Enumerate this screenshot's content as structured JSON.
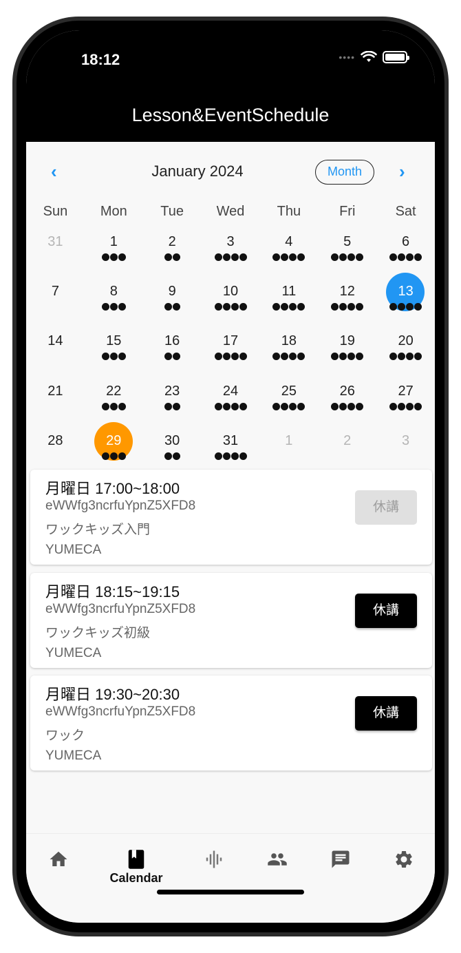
{
  "status": {
    "time": "18:12"
  },
  "app": {
    "title": "Lesson&EventSchedule"
  },
  "calendar": {
    "month_label": "January 2024",
    "view_button": "Month",
    "weekdays": [
      "Sun",
      "Mon",
      "Tue",
      "Wed",
      "Thu",
      "Fri",
      "Sat"
    ],
    "weeks": [
      [
        {
          "d": "31",
          "dots": 0,
          "other": true
        },
        {
          "d": "1",
          "dots": 3
        },
        {
          "d": "2",
          "dots": 2
        },
        {
          "d": "3",
          "dots": 4
        },
        {
          "d": "4",
          "dots": 4
        },
        {
          "d": "5",
          "dots": 4
        },
        {
          "d": "6",
          "dots": 4
        }
      ],
      [
        {
          "d": "7",
          "dots": 0
        },
        {
          "d": "8",
          "dots": 3
        },
        {
          "d": "9",
          "dots": 2
        },
        {
          "d": "10",
          "dots": 4
        },
        {
          "d": "11",
          "dots": 4
        },
        {
          "d": "12",
          "dots": 4
        },
        {
          "d": "13",
          "dots": 4,
          "today": true
        }
      ],
      [
        {
          "d": "14",
          "dots": 0
        },
        {
          "d": "15",
          "dots": 3
        },
        {
          "d": "16",
          "dots": 2
        },
        {
          "d": "17",
          "dots": 4
        },
        {
          "d": "18",
          "dots": 4
        },
        {
          "d": "19",
          "dots": 4
        },
        {
          "d": "20",
          "dots": 4
        }
      ],
      [
        {
          "d": "21",
          "dots": 0
        },
        {
          "d": "22",
          "dots": 3
        },
        {
          "d": "23",
          "dots": 2
        },
        {
          "d": "24",
          "dots": 4
        },
        {
          "d": "25",
          "dots": 4
        },
        {
          "d": "26",
          "dots": 4
        },
        {
          "d": "27",
          "dots": 4
        }
      ],
      [
        {
          "d": "28",
          "dots": 0
        },
        {
          "d": "29",
          "dots": 3,
          "selected": true
        },
        {
          "d": "30",
          "dots": 2
        },
        {
          "d": "31",
          "dots": 4
        },
        {
          "d": "1",
          "dots": 0,
          "other": true
        },
        {
          "d": "2",
          "dots": 0,
          "other": true
        },
        {
          "d": "3",
          "dots": 0,
          "other": true
        }
      ]
    ],
    "colors": {
      "accent": "#2196f3",
      "today": "#2196f3",
      "selected": "#ff9800"
    }
  },
  "lessons": [
    {
      "time": "月曜日 17:00~18:00",
      "id": "eWWfg3ncrfuYpnZ5XFD8",
      "name": "ワックキッズ入門",
      "org": "YUMECA",
      "button": "休講",
      "button_state": "disabled"
    },
    {
      "time": "月曜日 18:15~19:15",
      "id": "eWWfg3ncrfuYpnZ5XFD8",
      "name": "ワックキッズ初級",
      "org": "YUMECA",
      "button": "休講",
      "button_state": "active"
    },
    {
      "time": "月曜日 19:30~20:30",
      "id": "eWWfg3ncrfuYpnZ5XFD8",
      "name": "ワック",
      "org": "YUMECA",
      "button": "休講",
      "button_state": "active"
    }
  ],
  "bottom_nav": {
    "active_label": "Calendar",
    "items": [
      {
        "icon": "home-icon"
      },
      {
        "icon": "calendar-icon",
        "label": "Calendar"
      },
      {
        "icon": "audio-wave-icon"
      },
      {
        "icon": "people-icon"
      },
      {
        "icon": "message-icon"
      },
      {
        "icon": "settings-icon"
      }
    ]
  }
}
